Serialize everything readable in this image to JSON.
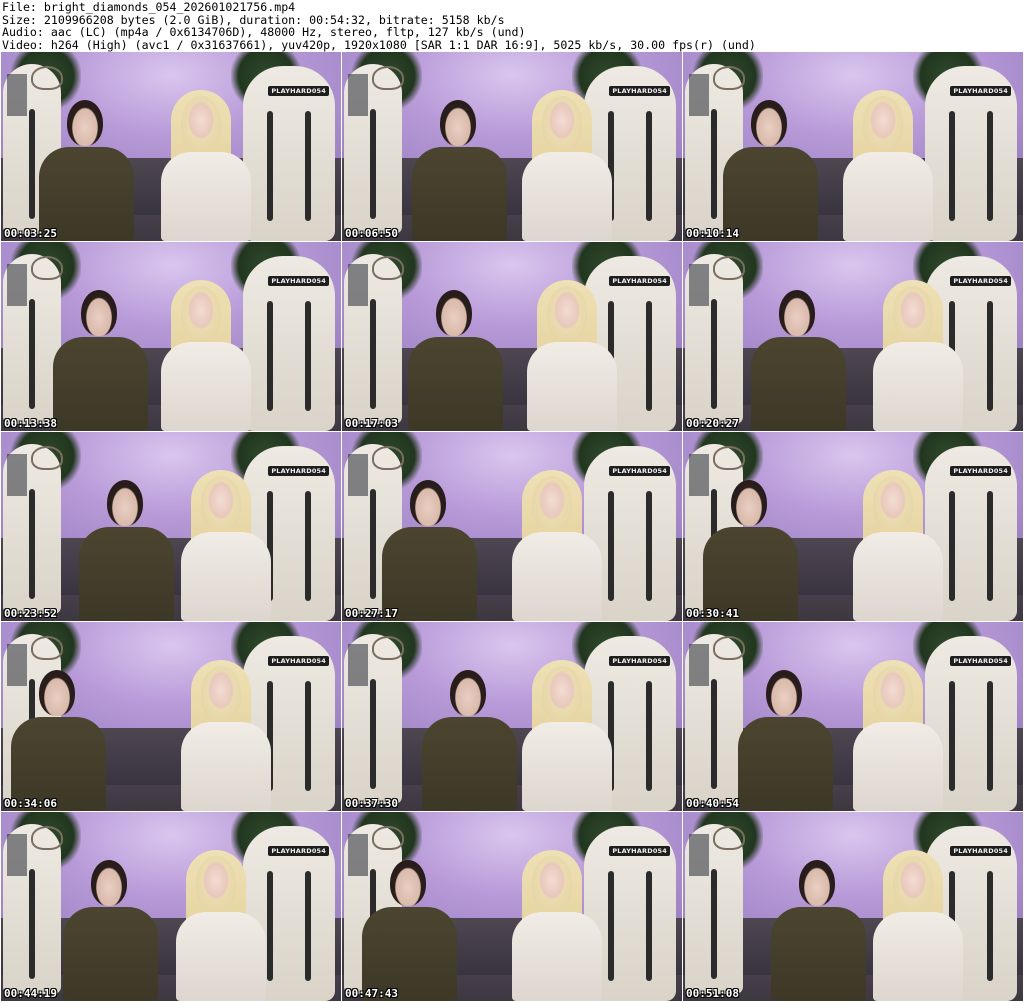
{
  "header": {
    "line1": "File: bright_diamonds_054_202601021756.mp4",
    "line2": "Size: 2109966208 bytes (2.0 GiB), duration: 00:54:32, bitrate: 5158 kb/s",
    "line3": "Audio: aac (LC) (mp4a / 0x6134706D), 48000 Hz, stereo, fltp, 127 kb/s (und)",
    "line4": "Video: h264 (High) (avc1 / 0x31637661), yuv420p, 1920x1080 [SAR 1:1 DAR 16:9], 5025 kb/s, 30.00 fps(r) (und)"
  },
  "brand_tag": "PLAYHARD054",
  "thumbnails": [
    {
      "timestamp": "00:03:25"
    },
    {
      "timestamp": "00:06:50"
    },
    {
      "timestamp": "00:10:14"
    },
    {
      "timestamp": "00:13:38"
    },
    {
      "timestamp": "00:17:03"
    },
    {
      "timestamp": "00:20:27"
    },
    {
      "timestamp": "00:23:52"
    },
    {
      "timestamp": "00:27:17"
    },
    {
      "timestamp": "00:30:41"
    },
    {
      "timestamp": "00:34:06"
    },
    {
      "timestamp": "00:37:30"
    },
    {
      "timestamp": "00:40:54"
    },
    {
      "timestamp": "00:44:19"
    },
    {
      "timestamp": "00:47:43"
    },
    {
      "timestamp": "00:51:08"
    }
  ],
  "colors": {
    "wall": "#b89ad8",
    "sofa": "#3a3440",
    "chair": "#e6e1d8",
    "timestamp_text": "#ffffff"
  }
}
